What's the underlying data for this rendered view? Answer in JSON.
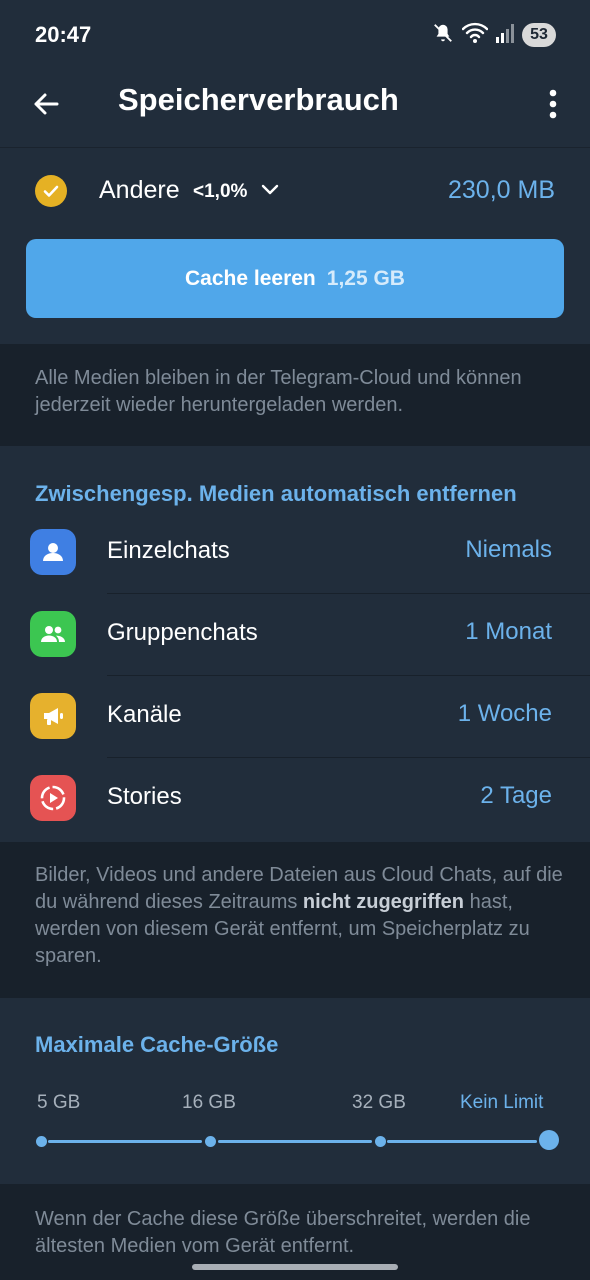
{
  "status_bar": {
    "time": "20:47",
    "battery": "53",
    "icons": [
      "mute-icon",
      "wifi-icon",
      "signal-icon"
    ]
  },
  "header": {
    "title": "Speicherverbrauch"
  },
  "category": {
    "label": "Andere",
    "percent": "<1,0%",
    "size": "230,0 MB"
  },
  "clear_button": {
    "label": "Cache leeren",
    "size": "1,25 GB"
  },
  "info_cloud": "Alle Medien bleiben in der Telegram-Cloud und können jederzeit wieder heruntergeladen werden.",
  "auto_remove": {
    "header": "Zwischengesp. Medien automatisch entfernen",
    "rows": [
      {
        "label": "Einzelchats",
        "value": "Niemals",
        "icon": "person-icon",
        "color": "#3f7fe3"
      },
      {
        "label": "Gruppenchats",
        "value": "1 Monat",
        "icon": "group-icon",
        "color": "#3cc651"
      },
      {
        "label": "Kanäle",
        "value": "1 Woche",
        "icon": "megaphone-icon",
        "color": "#e6b12d"
      },
      {
        "label": "Stories",
        "value": "2 Tage",
        "icon": "stories-icon",
        "color": "#e55353"
      }
    ]
  },
  "info_auto": {
    "part1": "Bilder, Videos und andere Dateien aus Cloud Chats, auf die du während dieses Zeitraums ",
    "bold": "nicht zugegriffen",
    "part2": " hast, werden von diesem Gerät entfernt, um Speicherplatz zu sparen."
  },
  "cache_size": {
    "header": "Maximale Cache-Größe",
    "options": [
      "5 GB",
      "16 GB",
      "32 GB",
      "Kein Limit"
    ],
    "selected": "Kein Limit"
  },
  "info_cache": "Wenn der Cache diese Größe überschreitet, werden die ältesten Medien vom Gerät entfernt.",
  "colors": {
    "accent": "#6cb2eb",
    "button": "#50a7ea",
    "check": "#e5b124"
  }
}
